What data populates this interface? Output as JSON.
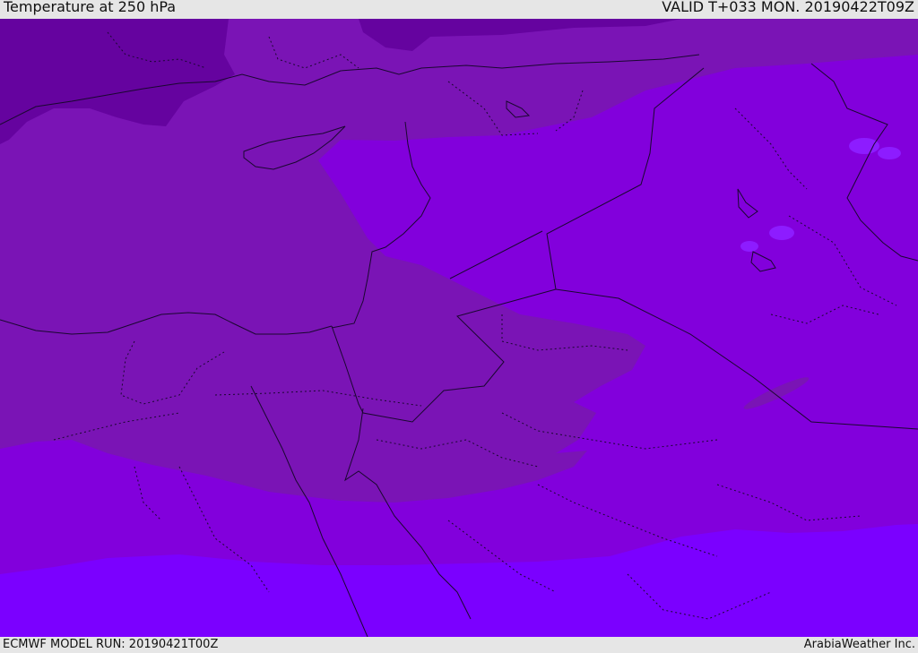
{
  "header": {
    "title": "Temperature at 250 hPa",
    "valid": "VALID T+033 MON. 20190422T09Z"
  },
  "footer": {
    "model_run": "ECMWF MODEL RUN: 20190421T00Z",
    "credit": "ArabiaWeather Inc."
  },
  "map": {
    "colors": {
      "band_coldest": "#65039f",
      "band_cold": "#7a14b5",
      "band_mid": "#8200dc",
      "band_warm": "#7b00ff",
      "borders": "#1a0730"
    }
  }
}
